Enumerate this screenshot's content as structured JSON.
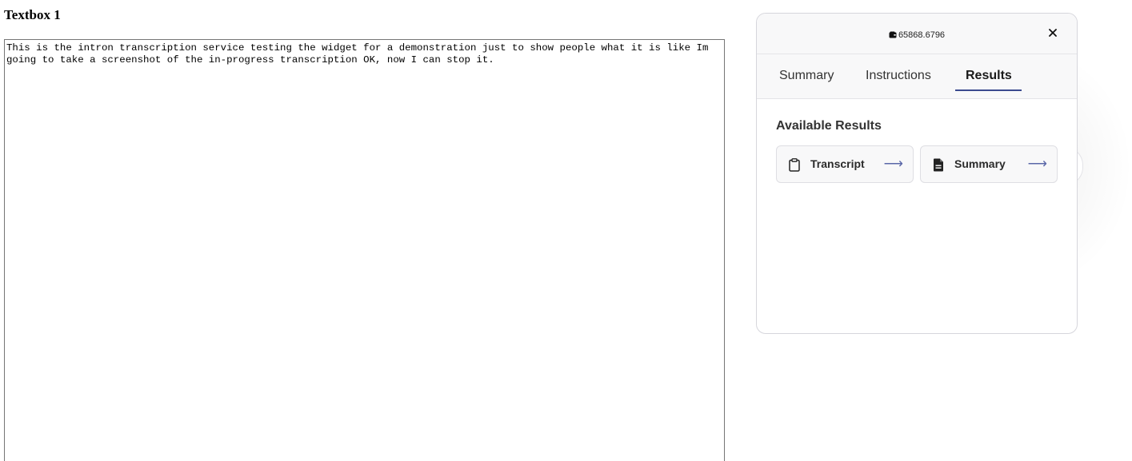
{
  "page": {
    "heading": "Textbox 1",
    "textbox_value": "This is the intron transcription service testing the widget for a demonstration just to show people what it is like Im going to take a screenshot of the in-progress transcription OK, now I can stop it."
  },
  "widget": {
    "session_id": "65868.6796",
    "session_icon": "wallet-icon",
    "close_icon": "close-icon",
    "tabs": [
      {
        "label": "Summary",
        "active": false
      },
      {
        "label": "Instructions",
        "active": false
      },
      {
        "label": "Results",
        "active": true
      }
    ],
    "results": {
      "title": "Available Results",
      "items": [
        {
          "label": "Transcript",
          "icon": "clipboard-icon",
          "arrow": "⟶"
        },
        {
          "label": "Summary",
          "icon": "document-icon",
          "arrow": "⟶"
        }
      ]
    },
    "colors": {
      "accent": "#3b4a8f",
      "arrow": "#5a67a8"
    }
  }
}
